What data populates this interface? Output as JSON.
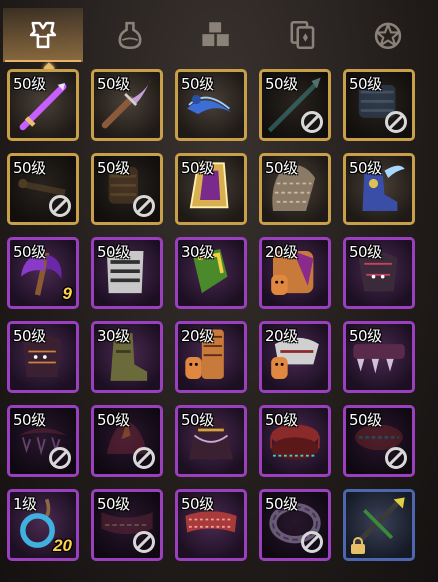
{
  "tabs": [
    {
      "name": "tab-equipment",
      "icon": "armor-icon",
      "active": true
    },
    {
      "name": "tab-consumables",
      "icon": "potion-icon",
      "active": false
    },
    {
      "name": "tab-materials",
      "icon": "cubes-icon",
      "active": false
    },
    {
      "name": "tab-cards",
      "icon": "cards-icon",
      "active": false
    },
    {
      "name": "tab-emblems",
      "icon": "star-emblem-icon",
      "active": false
    }
  ],
  "rows": [
    [
      {
        "level": "50级",
        "frame": "gold",
        "item": "purple-sword",
        "forbid": false
      },
      {
        "level": "50级",
        "frame": "gold",
        "item": "dark-blade",
        "forbid": false
      },
      {
        "level": "50级",
        "frame": "gold",
        "item": "blue-serpent-blade",
        "forbid": false
      },
      {
        "level": "50级",
        "frame": "gold",
        "item": "teal-spear",
        "forbid": true
      },
      {
        "level": "50级",
        "frame": "gold",
        "item": "blue-greaves",
        "forbid": true
      }
    ],
    [
      {
        "level": "50级",
        "frame": "gold",
        "item": "dark-staff",
        "forbid": true
      },
      {
        "level": "50级",
        "frame": "gold",
        "item": "bronze-gauntlet",
        "forbid": true
      },
      {
        "level": "50级",
        "frame": "gold",
        "item": "golden-triangle-shield",
        "forbid": false
      },
      {
        "level": "50级",
        "frame": "gold",
        "item": "scale-armor",
        "forbid": false
      },
      {
        "level": "50级",
        "frame": "gold",
        "item": "winged-boot",
        "forbid": false
      }
    ],
    [
      {
        "level": "50级",
        "frame": "purple",
        "item": "purple-axe",
        "count": "9",
        "forbid": false
      },
      {
        "level": "50级",
        "frame": "purple",
        "item": "plate-chestguard",
        "forbid": false
      },
      {
        "level": "30级",
        "frame": "purple",
        "item": "green-gold-bracer",
        "forbid": false
      },
      {
        "level": "20级",
        "frame": "purple",
        "item": "doll-bundle",
        "forbid": false
      },
      {
        "level": "50级",
        "frame": "purple",
        "item": "dark-pauldron",
        "forbid": false
      }
    ],
    [
      {
        "level": "50级",
        "frame": "purple",
        "item": "shadow-pauldron",
        "forbid": false
      },
      {
        "level": "30级",
        "frame": "purple",
        "item": "leather-boot",
        "forbid": false
      },
      {
        "level": "20级",
        "frame": "purple",
        "item": "doll-scroll",
        "forbid": false
      },
      {
        "level": "20级",
        "frame": "purple",
        "item": "doll-armor",
        "forbid": false
      },
      {
        "level": "50级",
        "frame": "purple",
        "item": "spiked-belt",
        "forbid": false
      }
    ],
    [
      {
        "level": "50级",
        "frame": "purple",
        "item": "spiked-collar",
        "forbid": true
      },
      {
        "level": "50级",
        "frame": "purple",
        "item": "orange-crest",
        "forbid": true
      },
      {
        "level": "50级",
        "frame": "purple",
        "item": "spiked-helm",
        "forbid": false
      },
      {
        "level": "50级",
        "frame": "purple",
        "item": "red-drum-ring",
        "forbid": false
      },
      {
        "level": "50级",
        "frame": "purple",
        "item": "red-bracer",
        "forbid": true
      }
    ],
    [
      {
        "level": "1级",
        "frame": "purple",
        "item": "blue-ring-amulet",
        "count": "20",
        "forbid": false
      },
      {
        "level": "50级",
        "frame": "purple",
        "item": "chain-belt",
        "forbid": true
      },
      {
        "level": "50级",
        "frame": "purple",
        "item": "red-coil-belt",
        "forbid": false
      },
      {
        "level": "50级",
        "frame": "purple",
        "item": "silver-ring",
        "forbid": true
      },
      {
        "level": "",
        "frame": "blue",
        "item": "green-crossbow",
        "locked": true,
        "forbid": false
      }
    ]
  ],
  "colors": {
    "gold_frame": "#c9a04a",
    "purple_frame": "#9a3fbd",
    "blue_frame": "#4c66b0",
    "tab_active": "#e6b56a",
    "count_text": "#ffd24a"
  }
}
